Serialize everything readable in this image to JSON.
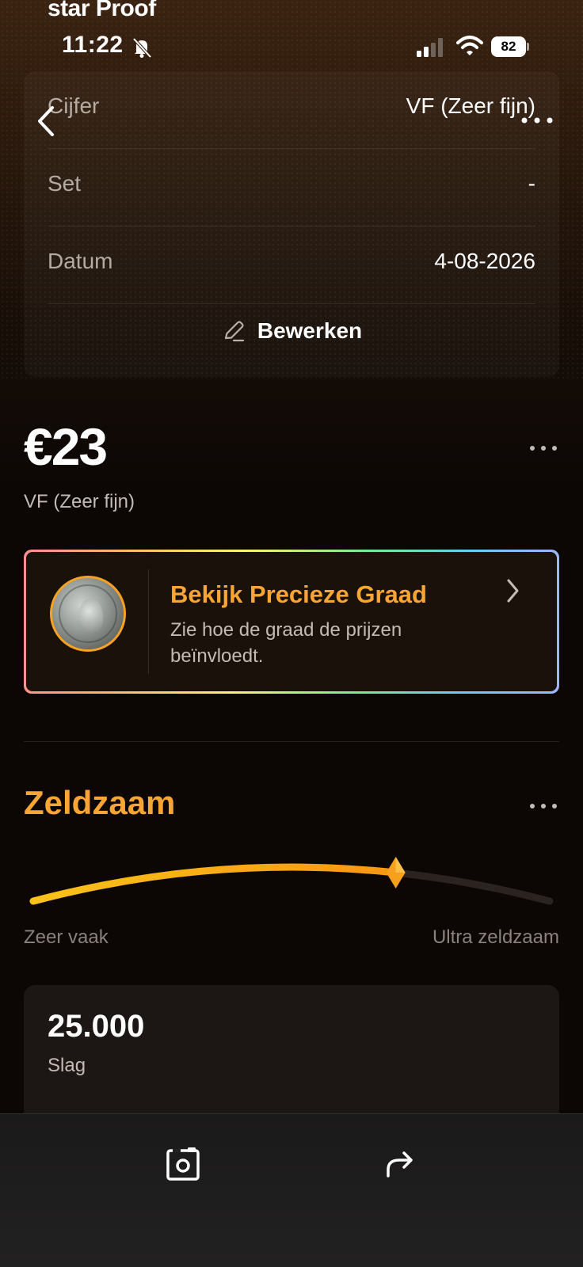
{
  "header": {
    "app_title": "star Proof",
    "status_time": "11:22",
    "battery_level": "82"
  },
  "details": {
    "rows": [
      {
        "label": "Cijfer",
        "value": "VF (Zeer fijn)"
      },
      {
        "label": "Set",
        "value": "-"
      },
      {
        "label": "Datum",
        "value": "4-08-2026"
      }
    ],
    "edit_label": "Bewerken"
  },
  "price": {
    "value": "€23",
    "grade": "VF (Zeer fijn)"
  },
  "grade_card": {
    "title": "Bekijk Precieze Graad",
    "description": "Zie hoe de graad de prijzen beïnvloedt."
  },
  "rarity": {
    "title": "Zeldzaam",
    "left_label": "Zeer vaak",
    "right_label": "Ultra zeldzaam",
    "level": 0.7,
    "colors": {
      "start": "#f9c21a",
      "end": "#f7840e",
      "track": "#2a2320"
    }
  },
  "mintage": {
    "value": "25.000",
    "label": "Slag"
  },
  "icons": {
    "back": "chevron-left-icon",
    "more": "more-horizontal-icon",
    "edit": "pencil-icon",
    "camera": "camera-icon",
    "share": "share-arrow-icon"
  },
  "theme": {
    "accent": "#f7a534",
    "background": "#0c0705"
  }
}
